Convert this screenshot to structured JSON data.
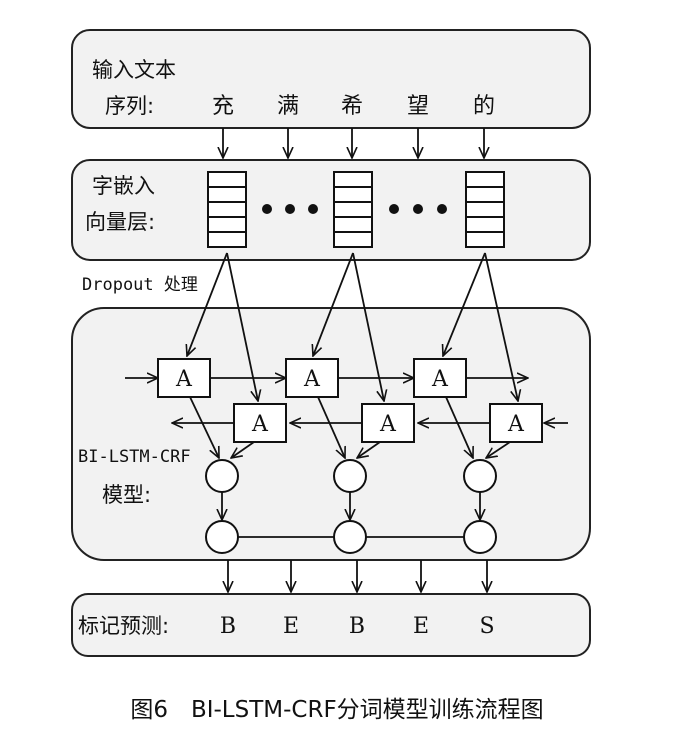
{
  "input_box": {
    "label_line1": "输入文本",
    "label_line2": "序列:",
    "tokens": [
      "充",
      "满",
      "希",
      "望",
      "的"
    ]
  },
  "embedding_box": {
    "label_line1": "字嵌入",
    "label_line2": "向量层:"
  },
  "dropout_label": "Dropout 处理",
  "model_box": {
    "label_line1": "BI-LSTM-CRF",
    "label_line2": "模型:",
    "cell_label": "A"
  },
  "output_box": {
    "label": "标记预测:",
    "tags": [
      "B",
      "E",
      "B",
      "E",
      "S"
    ]
  },
  "caption": "图6　BI-LSTM-CRF分词模型训练流程图"
}
